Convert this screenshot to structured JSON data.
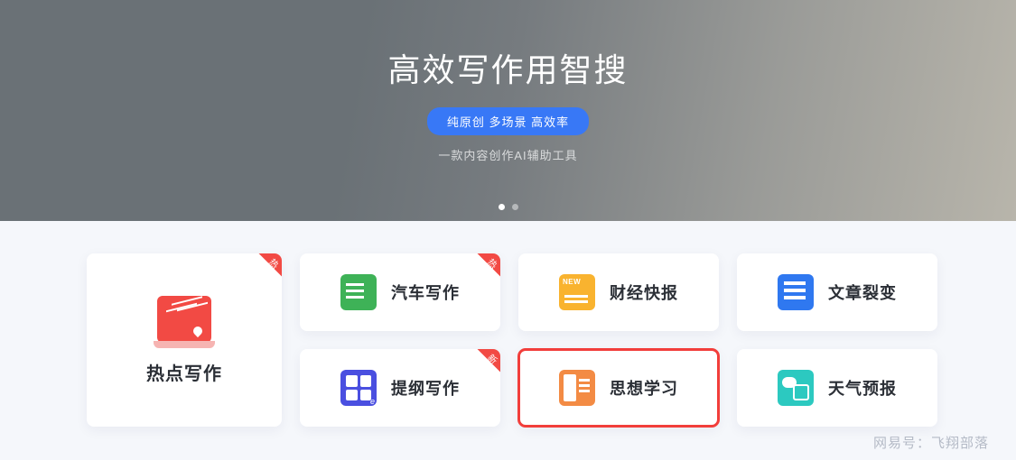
{
  "hero": {
    "title": "高效写作用智搜",
    "badge": "纯原创 多场景 高效率",
    "subtitle": "一款内容创作AI辅助工具"
  },
  "ribbons": {
    "hot": "热",
    "new": "新"
  },
  "cards": {
    "hot_writing": "热点写作",
    "car_writing": "汽车写作",
    "finance_news": "财经快报",
    "article_split": "文章裂变",
    "outline_writing": "提纲写作",
    "thought_study": "思想学习",
    "weather_report": "天气预报"
  },
  "watermark": "网易号：飞翔部落"
}
